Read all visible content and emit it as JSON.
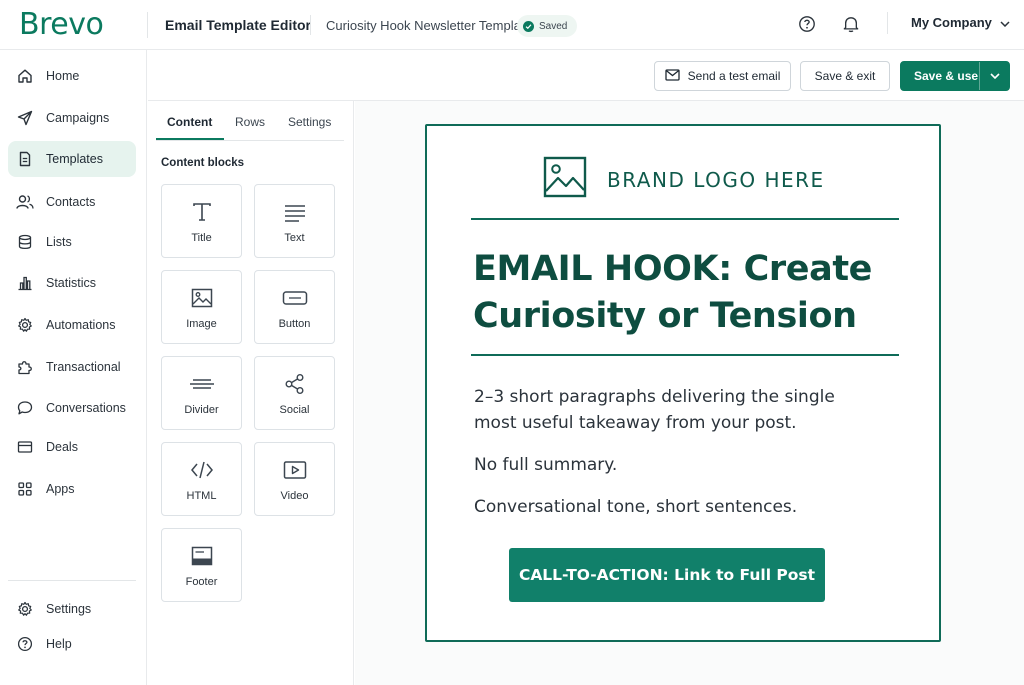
{
  "app": {
    "logo_text": "Brevo",
    "brand_color": "#0b7a5f"
  },
  "header": {
    "editor_title": "Email Template Editor",
    "template_name": "Curiosity Hook Newsletter Template",
    "saved_label": "Saved",
    "help_icon": "help-circle-icon",
    "notifications_icon": "bell-icon",
    "company_label": "My Company"
  },
  "sidebar": {
    "items": [
      {
        "label": "Home",
        "icon": "home-icon",
        "active": false
      },
      {
        "label": "Campaigns",
        "icon": "send-icon",
        "active": false
      },
      {
        "label": "Templates",
        "icon": "document-icon",
        "active": true
      },
      {
        "label": "Contacts",
        "icon": "users-icon",
        "active": false
      },
      {
        "label": "Lists",
        "icon": "database-icon",
        "active": false
      },
      {
        "label": "Statistics",
        "icon": "bar-chart-icon",
        "active": false
      },
      {
        "label": "Automations",
        "icon": "gear-icon",
        "active": false
      },
      {
        "label": "Transactional",
        "icon": "puzzle-icon",
        "active": false
      },
      {
        "label": "Conversations",
        "icon": "chat-icon",
        "active": false
      },
      {
        "label": "Deals",
        "icon": "card-icon",
        "active": false
      },
      {
        "label": "Apps",
        "icon": "grid-icon",
        "active": false
      }
    ],
    "bottom_items": [
      {
        "label": "Settings",
        "icon": "gear-icon"
      },
      {
        "label": "Help",
        "icon": "help-circle-icon"
      }
    ]
  },
  "actions": {
    "send_test_label": "Send a test email",
    "save_exit_label": "Save & exit",
    "save_use_label": "Save & use"
  },
  "panel": {
    "tabs": [
      "Content",
      "Rows",
      "Settings"
    ],
    "active_tab": "Content",
    "heading": "Content blocks",
    "blocks": [
      {
        "label": "Title",
        "icon": "title-icon"
      },
      {
        "label": "Text",
        "icon": "text-lines-icon"
      },
      {
        "label": "Image",
        "icon": "image-icon"
      },
      {
        "label": "Button",
        "icon": "button-icon"
      },
      {
        "label": "Divider",
        "icon": "divider-icon"
      },
      {
        "label": "Social",
        "icon": "share-icon"
      },
      {
        "label": "HTML",
        "icon": "code-icon"
      },
      {
        "label": "Video",
        "icon": "video-icon"
      },
      {
        "label": "Footer",
        "icon": "footer-icon"
      }
    ]
  },
  "email": {
    "brand_logo_text": "BRAND LOGO HERE",
    "headline_line1": "EMAIL HOOK: Create",
    "headline_line2": "Curiosity or Tension",
    "paragraph1_line1": "2–3 short paragraphs delivering the single",
    "paragraph1_line2": "most useful takeaway from your post.",
    "paragraph2": "No full summary.",
    "paragraph3": "Conversational tone, short sentences.",
    "cta_label": "CALL-TO-ACTION: Link to Full Post",
    "accent_color": "#0f6b58"
  }
}
